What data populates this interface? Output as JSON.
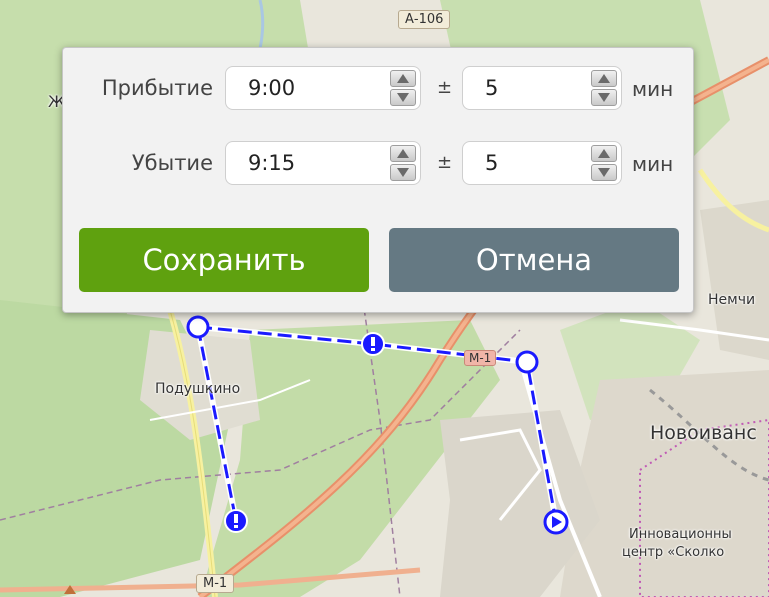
{
  "map": {
    "labels": {
      "podushkino": "Подушкино",
      "novoivan": "Новоиванс",
      "nemchi": "Немчи",
      "innov_line1": "Инновационны",
      "innov_line2": "центр «Сколко",
      "letter_zh": "Ж"
    },
    "roads": {
      "a106": "А-106",
      "m1": "М-1",
      "m1_mid": "М-1"
    }
  },
  "dialog": {
    "arrival": {
      "label": "Прибытие",
      "time": "9:00",
      "plus_minus": "±",
      "tolerance": "5",
      "unit": "мин"
    },
    "departure": {
      "label": "Убытие",
      "time": "9:15",
      "plus_minus": "±",
      "tolerance": "5",
      "unit": "мин"
    },
    "save_label": "Сохранить",
    "cancel_label": "Отмена"
  },
  "colors": {
    "save_button": "#5fa10f",
    "cancel_button": "#657983",
    "route": "#1a1aff"
  }
}
